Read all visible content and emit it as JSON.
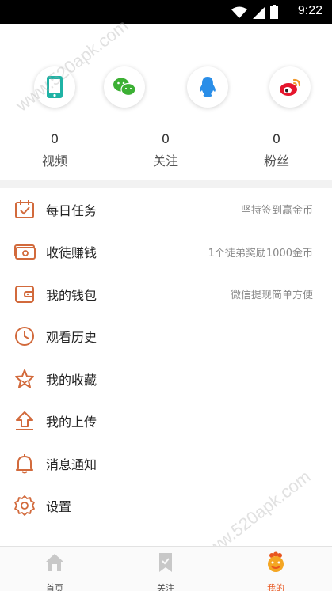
{
  "status_bar": {
    "time": "9:22"
  },
  "login": {
    "buttons": [
      {
        "icon": "phone-icon"
      },
      {
        "icon": "wechat-icon"
      },
      {
        "icon": "qq-icon"
      },
      {
        "icon": "weibo-icon"
      }
    ]
  },
  "stats": [
    {
      "value": "0",
      "label": "视频"
    },
    {
      "value": "0",
      "label": "关注"
    },
    {
      "value": "0",
      "label": "粉丝"
    }
  ],
  "menu": [
    {
      "label": "每日任务",
      "hint": "坚持签到赢金币",
      "icon": "calendar-check-icon"
    },
    {
      "label": "收徒赚钱",
      "hint": "1个徒弟奖励1000金币",
      "icon": "money-icon"
    },
    {
      "label": "我的钱包",
      "hint": "微信提现简单方便",
      "icon": "wallet-icon"
    },
    {
      "label": "观看历史",
      "hint": "",
      "icon": "clock-icon"
    },
    {
      "label": "我的收藏",
      "hint": "",
      "icon": "star-icon"
    },
    {
      "label": "我的上传",
      "hint": "",
      "icon": "upload-icon"
    },
    {
      "label": "消息通知",
      "hint": "",
      "icon": "bell-icon"
    },
    {
      "label": "设置",
      "hint": "",
      "icon": "gear-icon"
    }
  ],
  "bottom_nav": [
    {
      "label": "首页",
      "icon": "home-icon"
    },
    {
      "label": "关注",
      "icon": "bookmark-icon"
    },
    {
      "label": "我的",
      "icon": "profile-face-icon",
      "active": true
    }
  ],
  "watermark": "www.520apk.com",
  "colors": {
    "accent": "#e8561f",
    "icon_stroke": "#d26a3c",
    "wechat": "#3cb034",
    "qq": "#2a8ee8",
    "phone": "#1fb3a5"
  }
}
